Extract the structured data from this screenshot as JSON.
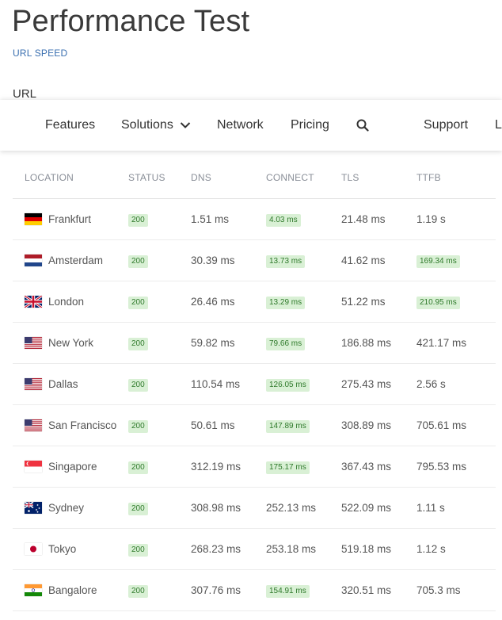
{
  "header": {
    "title": "Performance Test",
    "subtitle": "URL SPEED",
    "url_label": "URL"
  },
  "nav": {
    "items": [
      "Features",
      "Solutions",
      "Network",
      "Pricing"
    ],
    "support": "Support",
    "partial": "L"
  },
  "table": {
    "headers": [
      "LOCATION",
      "STATUS",
      "DNS",
      "CONNECT",
      "TLS",
      "TTFB"
    ],
    "rows": [
      {
        "flag": "de",
        "location": "Frankfurt",
        "status": "200",
        "dns": "1.51 ms",
        "connect": "4.03 ms",
        "connect_badge": true,
        "tls": "21.48 ms",
        "ttfb": "1.19 s",
        "ttfb_badge": false
      },
      {
        "flag": "nl",
        "location": "Amsterdam",
        "status": "200",
        "dns": "30.39 ms",
        "connect": "13.73 ms",
        "connect_badge": true,
        "tls": "41.62 ms",
        "ttfb": "169.34 ms",
        "ttfb_badge": true
      },
      {
        "flag": "gb",
        "location": "London",
        "status": "200",
        "dns": "26.46 ms",
        "connect": "13.29 ms",
        "connect_badge": true,
        "tls": "51.22 ms",
        "ttfb": "210.95 ms",
        "ttfb_badge": true
      },
      {
        "flag": "us",
        "location": "New York",
        "status": "200",
        "dns": "59.82 ms",
        "connect": "79.66 ms",
        "connect_badge": true,
        "tls": "186.88 ms",
        "ttfb": "421.17 ms",
        "ttfb_badge": false
      },
      {
        "flag": "us",
        "location": "Dallas",
        "status": "200",
        "dns": "110.54 ms",
        "connect": "126.05 ms",
        "connect_badge": true,
        "tls": "275.43 ms",
        "ttfb": "2.56 s",
        "ttfb_badge": false
      },
      {
        "flag": "us",
        "location": "San Francisco",
        "status": "200",
        "dns": "50.61 ms",
        "connect": "147.89 ms",
        "connect_badge": true,
        "tls": "308.89 ms",
        "ttfb": "705.61 ms",
        "ttfb_badge": false
      },
      {
        "flag": "sg",
        "location": "Singapore",
        "status": "200",
        "dns": "312.19 ms",
        "connect": "175.17 ms",
        "connect_badge": true,
        "tls": "367.43 ms",
        "ttfb": "795.53 ms",
        "ttfb_badge": false
      },
      {
        "flag": "au",
        "location": "Sydney",
        "status": "200",
        "dns": "308.98 ms",
        "connect": "252.13 ms",
        "connect_badge": false,
        "tls": "522.09 ms",
        "ttfb": "1.11 s",
        "ttfb_badge": false
      },
      {
        "flag": "jp",
        "location": "Tokyo",
        "status": "200",
        "dns": "268.23 ms",
        "connect": "253.18 ms",
        "connect_badge": false,
        "tls": "519.18 ms",
        "ttfb": "1.12 s",
        "ttfb_badge": false
      },
      {
        "flag": "in",
        "location": "Bangalore",
        "status": "200",
        "dns": "307.76 ms",
        "connect": "154.91 ms",
        "connect_badge": true,
        "tls": "320.51 ms",
        "ttfb": "705.3 ms",
        "ttfb_badge": false
      }
    ]
  },
  "colors": {
    "badge_bg": "#d9f0d5",
    "badge_text": "#2f7a2b",
    "subtitle": "#3a6fb0"
  }
}
